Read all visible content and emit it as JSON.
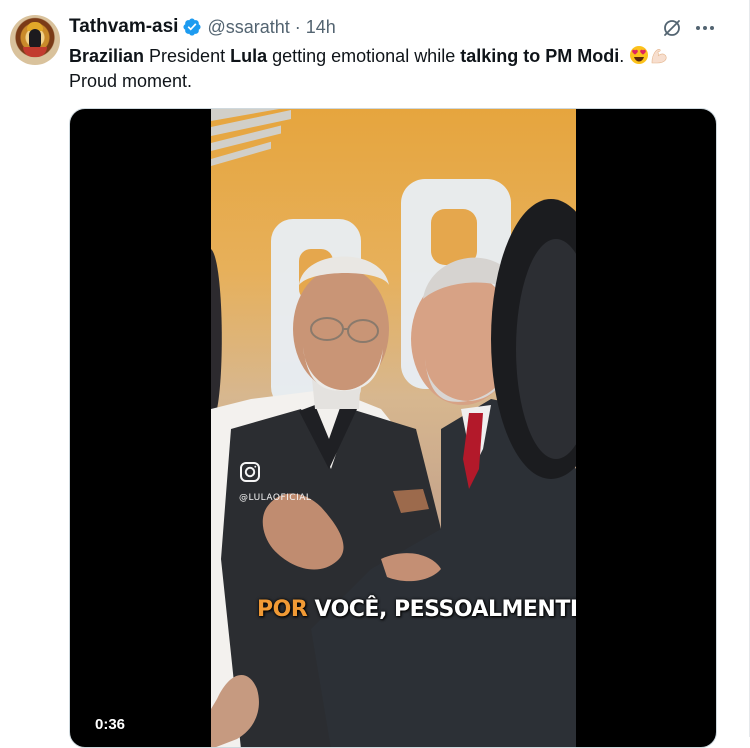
{
  "tweet": {
    "author": {
      "display_name": "Tathvam-asi",
      "verified": true,
      "handle": "@ssaratht",
      "separator": "·",
      "time": "14h"
    },
    "text": {
      "t1": "Brazilian",
      "t2": " President ",
      "t3": "Lula",
      "t4": " getting emotional while ",
      "t5": "talking to PM Modi",
      "t6": ". ",
      "line2": "Proud moment."
    },
    "emojis": [
      "heart-eyes-face-emoji",
      "flexed-biceps-emoji"
    ],
    "actions": {
      "grok_icon": "grok-icon",
      "more_icon": "more-options-icon"
    }
  },
  "video": {
    "watermark": "@LULAOFICIAL",
    "caption_highlight": "POR",
    "caption_rest": " VOCÊ, PESSOALMENTE.",
    "duration": "0:36"
  },
  "colors": {
    "text": "#0f1419",
    "secondary": "#536471",
    "verified": "#1d9bf0",
    "caption_highlight": "#f19a35"
  }
}
